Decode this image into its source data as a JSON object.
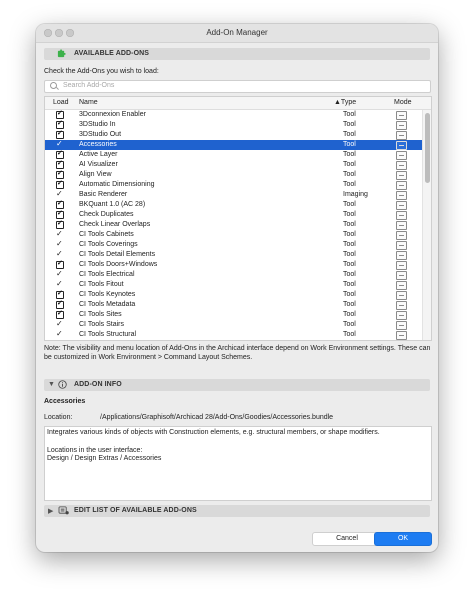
{
  "window": {
    "title": "Add-On Manager"
  },
  "sections": {
    "available": "AVAILABLE ADD-ONS",
    "info": "ADD-ON INFO",
    "edit": "EDIT LIST OF AVAILABLE ADD-ONS"
  },
  "instruction": "Check the Add-Ons you wish to load:",
  "search": {
    "placeholder": "Search Add-Ons"
  },
  "columns": {
    "load": "Load",
    "name": "Name",
    "type": "▲Type",
    "mode": "Mode"
  },
  "rows": [
    {
      "name": "3Dconnexion Enabler",
      "type": "Tool",
      "load": "checkbox"
    },
    {
      "name": "3DStudio In",
      "type": "Tool",
      "load": "checkbox"
    },
    {
      "name": "3DStudio Out",
      "type": "Tool",
      "load": "checkbox"
    },
    {
      "name": "Accessories",
      "type": "Tool",
      "load": "tick",
      "selected": true
    },
    {
      "name": "Active Layer",
      "type": "Tool",
      "load": "checkbox"
    },
    {
      "name": "AI Visualizer",
      "type": "Tool",
      "load": "checkbox"
    },
    {
      "name": "Align View",
      "type": "Tool",
      "load": "checkbox"
    },
    {
      "name": "Automatic Dimensioning",
      "type": "Tool",
      "load": "checkbox"
    },
    {
      "name": "Basic Renderer",
      "type": "Imaging",
      "load": "tick"
    },
    {
      "name": "BKQuant 1.0 (AC 28)",
      "type": "Tool",
      "load": "checkbox"
    },
    {
      "name": "Check Duplicates",
      "type": "Tool",
      "load": "checkbox"
    },
    {
      "name": "Check Linear Overlaps",
      "type": "Tool",
      "load": "checkbox"
    },
    {
      "name": "CI Tools Cabinets",
      "type": "Tool",
      "load": "tick"
    },
    {
      "name": "CI Tools Coverings",
      "type": "Tool",
      "load": "tick"
    },
    {
      "name": "CI Tools Detail Elements",
      "type": "Tool",
      "load": "tick"
    },
    {
      "name": "CI Tools Doors+Windows",
      "type": "Tool",
      "load": "checkbox"
    },
    {
      "name": "CI Tools Electrical",
      "type": "Tool",
      "load": "tick"
    },
    {
      "name": "CI Tools Fitout",
      "type": "Tool",
      "load": "tick"
    },
    {
      "name": "CI Tools Keynotes",
      "type": "Tool",
      "load": "checkbox"
    },
    {
      "name": "CI Tools Metadata",
      "type": "Tool",
      "load": "checkbox"
    },
    {
      "name": "CI Tools Sites",
      "type": "Tool",
      "load": "checkbox"
    },
    {
      "name": "CI Tools Stairs",
      "type": "Tool",
      "load": "tick"
    },
    {
      "name": "CI Tools Structural",
      "type": "Tool",
      "load": "tick"
    }
  ],
  "note": "Note: The visibility and menu location of Add-Ons in the Archicad interface depend on Work Environment settings. These can be customized in Work Environment > Command Layout Schemes.",
  "info": {
    "name": "Accessories",
    "location_label": "Location:",
    "location_value": "/Applications/Graphisoft/Archicad 28/Add-Ons/Goodies/Accessories.bundle",
    "description": "Integrates various kinds of objects with Construction elements, e.g. structural members, or shape modifiers.",
    "locations_heading": "Locations in the user interface:",
    "locations_value": "Design / Design Extras / Accessories"
  },
  "buttons": {
    "cancel": "Cancel",
    "ok": "OK"
  },
  "colors": {
    "accent": "#1d7cf2",
    "selection": "#1f62cf",
    "addon_icon": "#3cb14a"
  }
}
